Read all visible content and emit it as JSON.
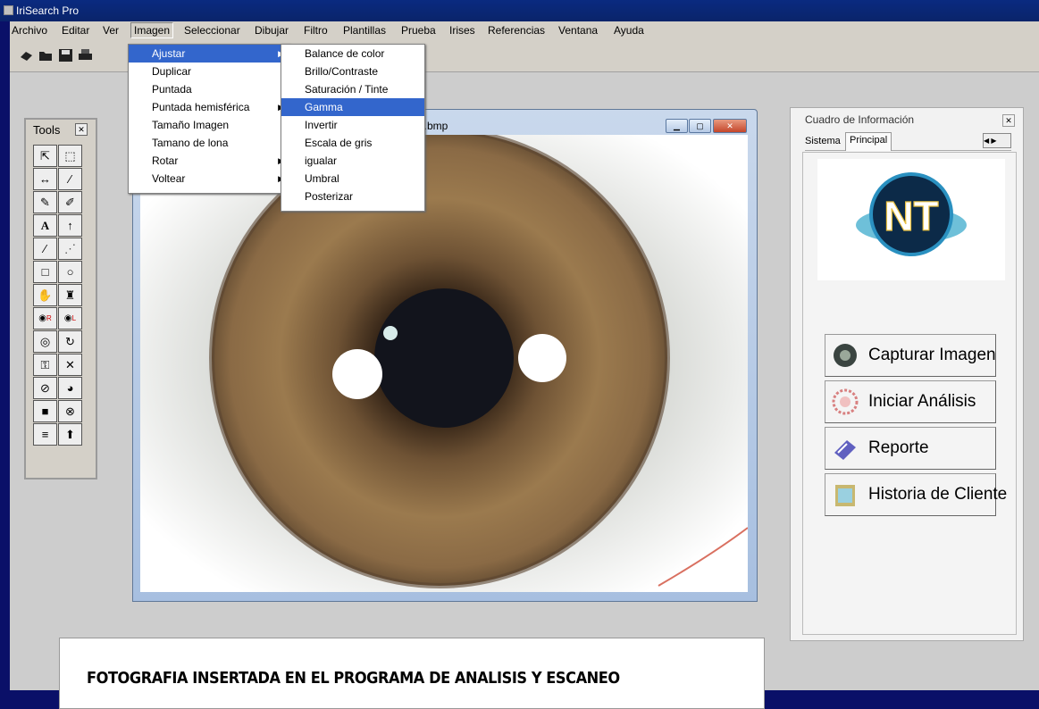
{
  "window": {
    "title": "IriSearch Pro"
  },
  "menubar": {
    "items": [
      "Archivo",
      "Editar",
      "Ver",
      "Imagen",
      "Seleccionar",
      "Dibujar",
      "Filtro",
      "Plantillas",
      "Prueba",
      "Irises",
      "Referencias",
      "Ventana",
      "Ayuda"
    ],
    "active": "Imagen"
  },
  "imagen_menu": {
    "items": [
      {
        "label": "Ajustar",
        "submenu": true,
        "highlighted": true
      },
      {
        "label": "Duplicar",
        "submenu": false
      },
      {
        "label": "Puntada",
        "submenu": false
      },
      {
        "label": "Puntada hemisférica",
        "submenu": true
      },
      {
        "label": "Tamaño Imagen",
        "submenu": false
      },
      {
        "label": "Tamano de lona",
        "submenu": false
      },
      {
        "label": "Rotar",
        "submenu": true
      },
      {
        "label": "Voltear",
        "submenu": true
      }
    ]
  },
  "ajustar_menu": {
    "items": [
      {
        "label": "Balance de color"
      },
      {
        "label": "Brillo/Contraste"
      },
      {
        "label": "Saturación / Tinte"
      },
      {
        "label": "Gamma",
        "highlighted": true
      },
      {
        "label": "Invertir"
      },
      {
        "label": "Escala de gris"
      },
      {
        "label": "igualar"
      },
      {
        "label": "Umbral"
      },
      {
        "label": "Posterizar"
      }
    ]
  },
  "tools": {
    "title": "Tools",
    "icons": [
      "select-arrow",
      "rect-select",
      "measure",
      "eyedropper",
      "pencil",
      "brush",
      "text",
      "arrow-up",
      "line",
      "dashed-line",
      "rectangle",
      "ellipse",
      "hand",
      "bottle",
      "zoom-right",
      "zoom-left",
      "target",
      "camera-rotate",
      "lock",
      "cross",
      "circle-slash",
      "globe",
      "fill-square",
      "circle-slash-2",
      "lines",
      "arrow-cursor"
    ]
  },
  "image_window": {
    "title": "zq.bmp"
  },
  "info_panel": {
    "title": "Cuadro de Información",
    "tabs": [
      "Sistema",
      "Principal"
    ],
    "active_tab": "Principal",
    "logo_text": "NT",
    "buttons": [
      {
        "label": "Capturar Imagen",
        "icon": "eye-icon"
      },
      {
        "label": "Iniciar Análisis",
        "icon": "mandala-icon"
      },
      {
        "label": "Reporte",
        "icon": "document-pen-icon"
      },
      {
        "label": "Historia de Cliente",
        "icon": "clipboard-icon"
      }
    ]
  },
  "caption": "FOTOGRAFIA INSERTADA EN EL PROGRAMA DE ANALISIS Y ESCANEO",
  "colors": {
    "desktop_frame": "#0a1068",
    "menu_highlight": "#3366cc",
    "workspace": "#cdcdcd"
  }
}
